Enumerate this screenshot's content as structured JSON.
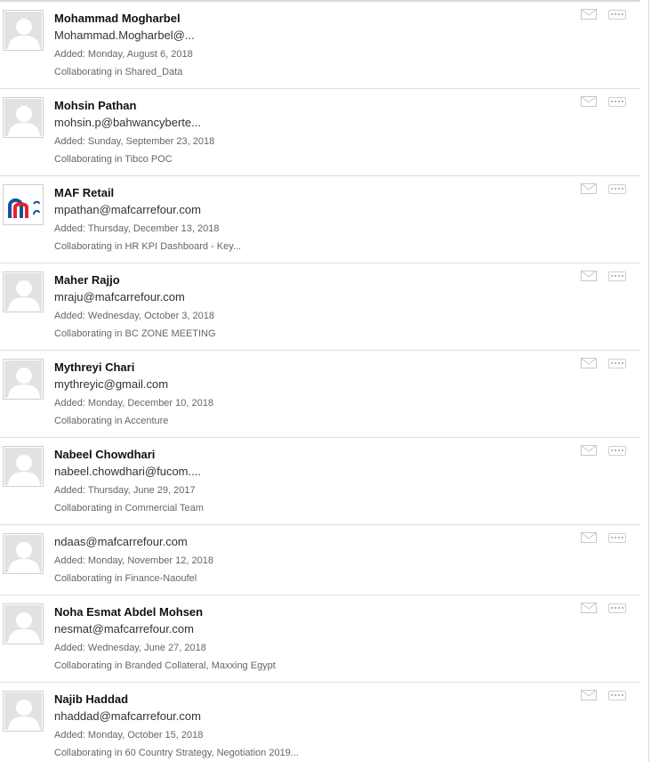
{
  "contacts": [
    {
      "name": "Mohammad Mogharbel",
      "email": "Mohammad.Mogharbel@...",
      "added": "Added: Monday, August 6, 2018",
      "collab": "Collaborating in Shared_Data"
    },
    {
      "name": "Mohsin Pathan",
      "email": "mohsin.p@bahwancyberte...",
      "added": "Added: Sunday, September 23, 2018",
      "collab": "Collaborating in Tibco POC"
    },
    {
      "name": "MAF Retail",
      "email": "mpathan@mafcarrefour.com",
      "added": "Added: Thursday, December 13, 2018",
      "collab": "Collaborating in HR KPI Dashboard - Key..."
    },
    {
      "name": "Maher Rajjo",
      "email": "mraju@mafcarrefour.com",
      "added": "Added: Wednesday, October 3, 2018",
      "collab": "Collaborating in BC ZONE MEETING"
    },
    {
      "name": "Mythreyi Chari",
      "email": "mythreyic@gmail.com",
      "added": "Added: Monday, December 10, 2018",
      "collab": "Collaborating in Accenture"
    },
    {
      "name": "Nabeel Chowdhari",
      "email": "nabeel.chowdhari@fucom....",
      "added": "Added: Thursday, June 29, 2017",
      "collab": "Collaborating in Commercial Team"
    },
    {
      "name": "",
      "email": "ndaas@mafcarrefour.com",
      "added": "Added: Monday, November 12, 2018",
      "collab": "Collaborating in Finance-Naoufel"
    },
    {
      "name": "Noha Esmat Abdel Mohsen",
      "email": "nesmat@mafcarrefour.com",
      "added": "Added: Wednesday, June 27, 2018",
      "collab": "Collaborating in Branded Collateral,  Maxxing Egypt"
    },
    {
      "name": "Najib Haddad",
      "email": "nhaddad@mafcarrefour.com",
      "added": "Added: Monday, October 15, 2018",
      "collab": "Collaborating in 60 Country Strategy,  Negotiation 2019..."
    }
  ],
  "icons": {
    "avatar": "default-user-silhouette-icon",
    "logo": "maf-carrefour-logo-icon",
    "mail": "envelope-icon",
    "more": "more-options-icon"
  },
  "colors": {
    "logo_blue": "#1c4f9c",
    "logo_red": "#e2262b"
  }
}
